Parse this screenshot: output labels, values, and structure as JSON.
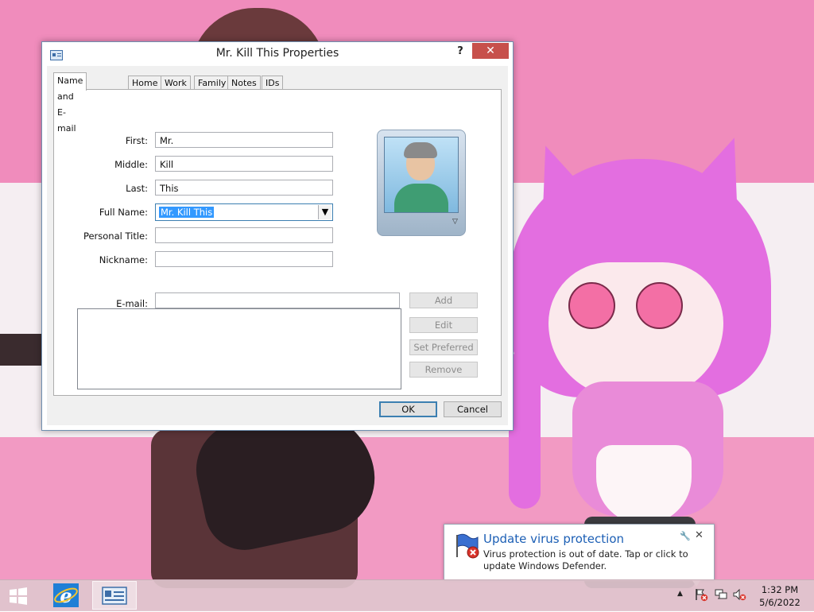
{
  "dialog": {
    "title": "Mr. Kill This Properties",
    "help_label": "?",
    "close_label": "✕",
    "tabs": [
      {
        "label": "Name and E-mail"
      },
      {
        "label": "Home"
      },
      {
        "label": "Work"
      },
      {
        "label": "Family"
      },
      {
        "label": "Notes"
      },
      {
        "label": "IDs"
      }
    ],
    "fields": {
      "first_label": "First:",
      "first_value": "Mr.",
      "middle_label": "Middle:",
      "middle_value": "Kill",
      "last_label": "Last:",
      "last_value": "This",
      "full_name_label": "Full Name:",
      "full_name_value": "Mr. Kill This",
      "personal_title_label": "Personal Title:",
      "personal_title_value": "",
      "nickname_label": "Nickname:",
      "nickname_value": "",
      "email_label": "E-mail:",
      "email_value": ""
    },
    "email_buttons": {
      "add": "Add",
      "edit": "Edit",
      "set_preferred": "Set Preferred",
      "remove": "Remove"
    },
    "ok_label": "OK",
    "cancel_label": "Cancel"
  },
  "notification": {
    "title": "Update virus protection",
    "body": "Virus protection is out of date. Tap or click to update Windows Defender.",
    "close_label": "✕"
  },
  "taskbar": {
    "time": "1:32 PM",
    "date": "5/6/2022"
  },
  "colors": {
    "accent": "#3399ff",
    "close_button": "#c7504b",
    "notification_title": "#1c5fb5"
  }
}
